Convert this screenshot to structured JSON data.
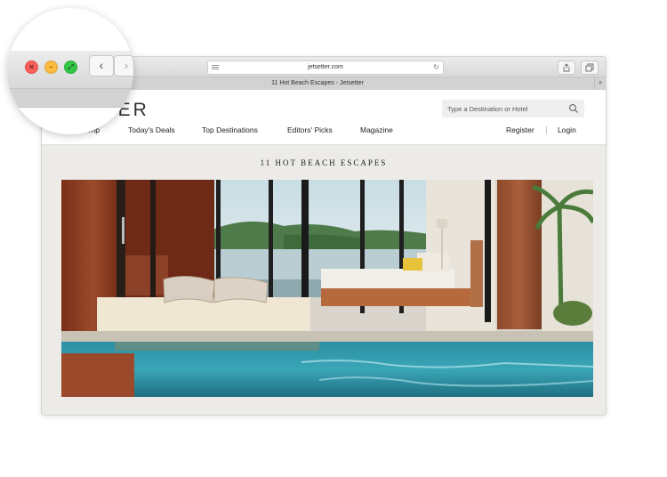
{
  "browser": {
    "url": "jetsetter.com",
    "tab_title": "11 Hot Beach Escapes - Jetsetter",
    "new_tab_label": "+",
    "back_glyph": "‹",
    "forward_glyph": "›",
    "close_glyph": "✕",
    "minimize_glyph": "–",
    "fullscreen_glyph": "⤢",
    "reload_icon": "reload-icon",
    "share_icon": "share-icon",
    "tabs_icon": "tabs-icon",
    "colors": {
      "close": "#fc605b",
      "minimize": "#fdbc40",
      "fullscreen": "#34c84a"
    }
  },
  "site": {
    "logo_partial": "SETTER",
    "search_placeholder": "Type a Destination or Hotel",
    "nav": {
      "book_a_trip": "Book a Trip",
      "todays_deals": "Today's Deals",
      "top_destinations": "Top Destinations",
      "editors_picks": "Editors' Picks",
      "magazine": "Magazine",
      "register": "Register",
      "login": "Login"
    }
  },
  "main": {
    "section_title": "11 HOT BEACH ESCAPES"
  }
}
